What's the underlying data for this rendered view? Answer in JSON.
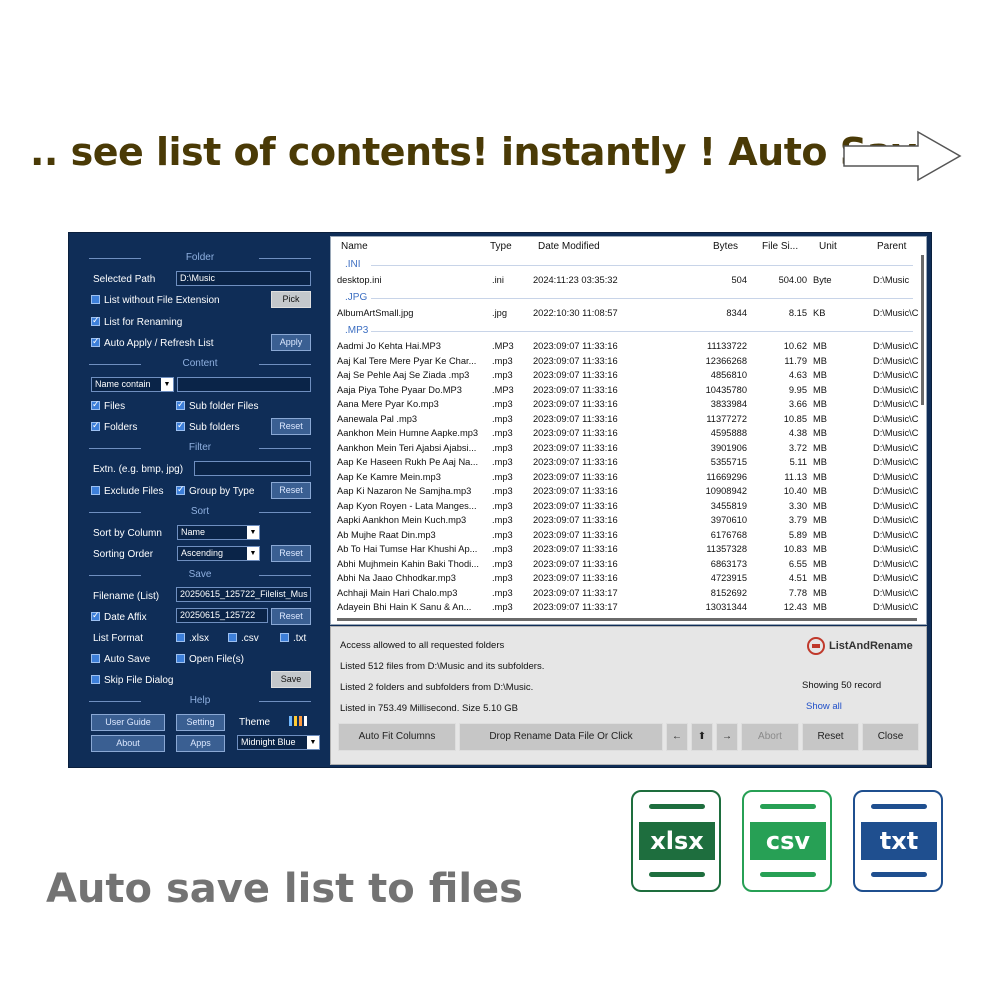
{
  "headline": ".. see list of contents! instantly ! Auto Save",
  "tagline": "Auto save list to files",
  "file_icons": [
    {
      "label": "xlsx",
      "color": "#1e6e3e"
    },
    {
      "label": "csv",
      "color": "#27a055"
    },
    {
      "label": "txt",
      "color": "#1f4f8f"
    }
  ],
  "panel": {
    "folder_section": "Folder",
    "selected_path_label": "Selected Path",
    "selected_path_value": "D:\\Music",
    "list_without_ext": "List without File Extension",
    "pick_button": "Pick",
    "list_for_renaming": "List for Renaming",
    "auto_apply": "Auto Apply / Refresh List",
    "apply_button": "Apply",
    "content_section": "Content",
    "name_contain": "Name contain",
    "files": "Files",
    "sub_folder_files": "Sub folder Files",
    "folders": "Folders",
    "sub_folders": "Sub folders",
    "reset_button": "Reset",
    "filter_section": "Filter",
    "extn_label": "Extn. (e.g. bmp, jpg)",
    "exclude_files": "Exclude Files",
    "group_by_type": "Group by Type",
    "sort_section": "Sort",
    "sort_by_column_label": "Sort by Column",
    "sort_by_column_value": "Name",
    "sorting_order_label": "Sorting Order",
    "sorting_order_value": "Ascending",
    "save_section": "Save",
    "filename_label": "Filename (List)",
    "filename_value": "20250615_125722_Filelist_Mus",
    "date_affix": "Date Affix",
    "date_affix_value": "20250615_125722",
    "list_format_label": "List Format",
    "fmt_xlsx": ".xlsx",
    "fmt_csv": ".csv",
    "fmt_txt": ".txt",
    "auto_save": "Auto Save",
    "open_files": "Open File(s)",
    "skip_file_dialog": "Skip File Dialog",
    "save_button": "Save",
    "help_section": "Help",
    "user_guide": "User Guide",
    "setting": "Setting",
    "theme_label": "Theme",
    "about": "About",
    "apps": "Apps",
    "theme_value": "Midnight Blue"
  },
  "table": {
    "columns": [
      "Name",
      "Type",
      "Date Modified",
      "Bytes",
      "File Si...",
      "Unit",
      "Parent"
    ],
    "groups": [
      {
        "label": ".INI",
        "rows": [
          [
            "desktop.ini",
            ".ini",
            "2024:11:23 03:35:32",
            "504",
            "504.00",
            "Byte",
            "D:\\Music"
          ]
        ]
      },
      {
        "label": ".JPG",
        "rows": [
          [
            "AlbumArtSmall.jpg",
            ".jpg",
            "2022:10:30 11:08:57",
            "8344",
            "8.15",
            "KB",
            "D:\\Music\\C"
          ]
        ]
      },
      {
        "label": ".MP3",
        "rows": [
          [
            "Aadmi Jo Kehta Hai.MP3",
            ".MP3",
            "2023:09:07 11:33:16",
            "11133722",
            "10.62",
            "MB",
            "D:\\Music\\C"
          ],
          [
            "Aaj Kal Tere Mere Pyar Ke Char...",
            ".mp3",
            "2023:09:07 11:33:16",
            "12366268",
            "11.79",
            "MB",
            "D:\\Music\\C"
          ],
          [
            "Aaj Se Pehle Aaj Se Ziada .mp3",
            ".mp3",
            "2023:09:07 11:33:16",
            "4856810",
            "4.63",
            "MB",
            "D:\\Music\\C"
          ],
          [
            "Aaja Piya Tohe Pyaar Do.MP3",
            ".MP3",
            "2023:09:07 11:33:16",
            "10435780",
            "9.95",
            "MB",
            "D:\\Music\\C"
          ],
          [
            "Aana Mere Pyar Ko.mp3",
            ".mp3",
            "2023:09:07 11:33:16",
            "3833984",
            "3.66",
            "MB",
            "D:\\Music\\C"
          ],
          [
            "Aanewala Pal .mp3",
            ".mp3",
            "2023:09:07 11:33:16",
            "11377272",
            "10.85",
            "MB",
            "D:\\Music\\C"
          ],
          [
            "Aankhon Mein Humne Aapke.mp3",
            ".mp3",
            "2023:09:07 11:33:16",
            "4595888",
            "4.38",
            "MB",
            "D:\\Music\\C"
          ],
          [
            "Aankhon Mein Teri Ajabsi Ajabsi...",
            ".mp3",
            "2023:09:07 11:33:16",
            "3901906",
            "3.72",
            "MB",
            "D:\\Music\\C"
          ],
          [
            "Aap Ke Haseen Rukh Pe Aaj Na...",
            ".mp3",
            "2023:09:07 11:33:16",
            "5355715",
            "5.11",
            "MB",
            "D:\\Music\\C"
          ],
          [
            "Aap Ke Kamre Mein.mp3",
            ".mp3",
            "2023:09:07 11:33:16",
            "11669296",
            "11.13",
            "MB",
            "D:\\Music\\C"
          ],
          [
            "Aap Ki Nazaron Ne Samjha.mp3",
            ".mp3",
            "2023:09:07 11:33:16",
            "10908942",
            "10.40",
            "MB",
            "D:\\Music\\C"
          ],
          [
            "Aap Kyon Royen - Lata Manges...",
            ".mp3",
            "2023:09:07 11:33:16",
            "3455819",
            "3.30",
            "MB",
            "D:\\Music\\C"
          ],
          [
            "Aapki Aankhon Mein Kuch.mp3",
            ".mp3",
            "2023:09:07 11:33:16",
            "3970610",
            "3.79",
            "MB",
            "D:\\Music\\C"
          ],
          [
            "Ab Mujhe Raat Din.mp3",
            ".mp3",
            "2023:09:07 11:33:16",
            "6176768",
            "5.89",
            "MB",
            "D:\\Music\\C"
          ],
          [
            "Ab To Hai Tumse Har Khushi Ap...",
            ".mp3",
            "2023:09:07 11:33:16",
            "11357328",
            "10.83",
            "MB",
            "D:\\Music\\C"
          ],
          [
            "Abhi Mujhmein Kahin Baki Thodi...",
            ".mp3",
            "2023:09:07 11:33:16",
            "6863173",
            "6.55",
            "MB",
            "D:\\Music\\C"
          ],
          [
            "Abhi Na Jaao Chhodkar.mp3",
            ".mp3",
            "2023:09:07 11:33:16",
            "4723915",
            "4.51",
            "MB",
            "D:\\Music\\C"
          ],
          [
            "Achhaji Main Hari Chalo.mp3",
            ".mp3",
            "2023:09:07 11:33:17",
            "8152692",
            "7.78",
            "MB",
            "D:\\Music\\C"
          ],
          [
            "Adayein Bhi Hain   K Sanu & An...",
            ".mp3",
            "2023:09:07 11:33:17",
            "13031344",
            "12.43",
            "MB",
            "D:\\Music\\C"
          ]
        ]
      }
    ]
  },
  "status": {
    "line1": "Access allowed to all requested folders",
    "line2": "Listed 512 files from D:\\Music and its subfolders.",
    "line3": "Listed 2 folders and subfolders from D:\\Music.",
    "line4": "Listed in 753.49 Millisecond.    Size 5.10 GB",
    "brand": "ListAndRename",
    "showing": "Showing 50 record",
    "show_all": "Show all"
  },
  "bottom_buttons": {
    "auto_fit": "Auto Fit Columns",
    "drop_rename": "Drop Rename Data File Or Click",
    "left": "←",
    "up": "⬆",
    "right": "→",
    "abort": "Abort",
    "reset": "Reset",
    "close": "Close"
  }
}
